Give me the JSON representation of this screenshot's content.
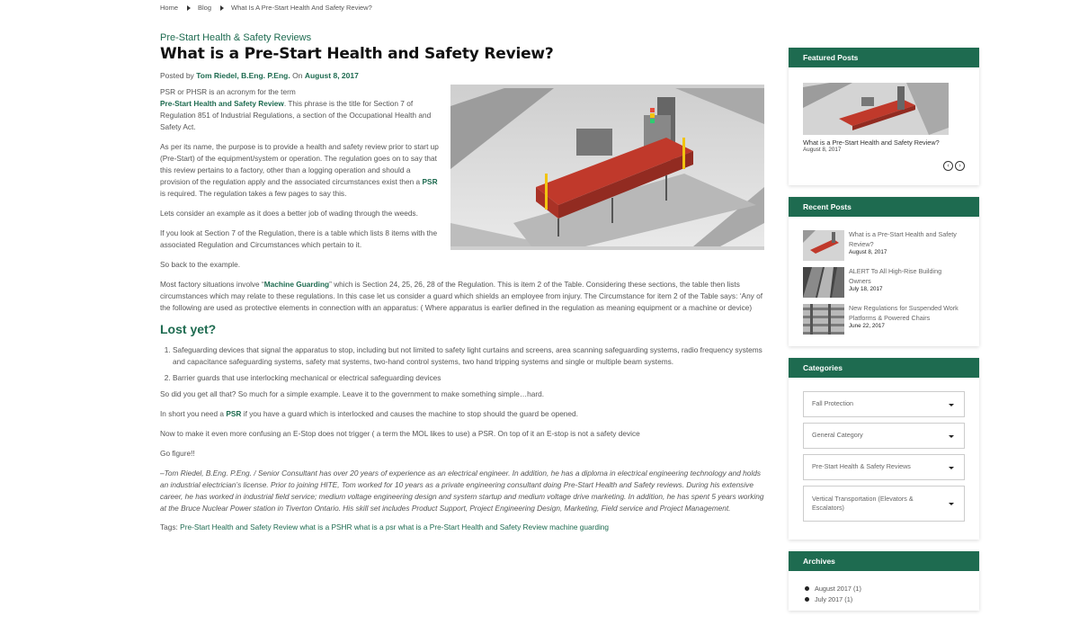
{
  "breadcrumb": {
    "home": "Home",
    "blog": "Blog",
    "current": "What Is A Pre-Start Health And Safety Review?"
  },
  "article": {
    "category": "Pre-Start Health & Safety Reviews",
    "title": "What is a Pre-Start Health and Safety Review?",
    "posted_by": "Posted by",
    "author": "Tom Riedel, B.Eng. P.Eng.",
    "on": "On",
    "date": "August 8, 2017",
    "p1_a": "PSR or PHSR is an acronym for the term",
    "p1_link": "Pre-Start Health and Safety Review",
    "p1_b": ". This phrase is the title for Section 7 of Regulation 851 of Industrial Regulations, a section of the Occupational Health and Safety Act.",
    "p2_a": "As per its name, the purpose is to provide a health and safety review prior to start up (Pre-Start) of the equipment/system or operation. The regulation goes on to say that this review pertains to a factory, other than a logging operation and should a provision of the regulation apply and the associated circumstances exist then a",
    "p2_link": "PSR",
    "p2_b": "is required. The regulation takes a few pages to say this.",
    "p3": "Lets consider an example as it does a better job of wading through the weeds.",
    "p4": "If you look at Section 7 of the Regulation, there is a table which lists 8 items with the associated Regulation and Circumstances which pertain to it.",
    "p5": "So back to the example.",
    "p6_a": "Most factory situations involve “",
    "p6_link": "Machine Guarding",
    "p6_b": "” which is Section 24, 25, 26, 28 of the Regulation. This is item 2 of the Table. Considering these sections, the table then lists circumstances which may relate to these regulations. In this case let us consider a guard which shields an employee from injury. The Circumstance for item 2 of the Table says: ‘Any of the following are used as protective elements in connection with an apparatus: ( Where apparatus is earlier defined in the regulation as meaning equipment or a machine or device)",
    "lost_heading": "Lost yet?",
    "list": [
      "Safeguarding devices that signal the apparatus to stop, including but not limited to safety light curtains and screens, area scanning safeguarding systems, radio frequency systems and capacitance safeguarding systems, safety mat systems, two-hand control systems, two hand tripping systems and single or multiple beam systems.",
      "Barrier guards that use interlocking mechanical or electrical safeguarding devices"
    ],
    "p7": "So did you get all that? So much for a simple example. Leave it to the government to make something simple…hard.",
    "p8_a": "In short you need a",
    "p8_link": "PSR",
    "p8_b": "if you have a guard which is interlocked and causes the machine to stop should the guard be opened.",
    "p9": "Now to make it even more confusing an E-Stop does not trigger ( a term the MOL likes to use) a PSR. On top of it an E-stop is not a safety device",
    "p10": "Go figure!!",
    "bio": "–Tom Riedel, B.Eng. P.Eng. / Senior Consultant has over 20 years of experience as an electrical engineer. In addition, he has a diploma in electrical engineering technology and holds an industrial electrician’s license. Prior to joining HITE, Tom worked for 10 years as a private engineering consultant doing Pre-Start Health and Safety reviews. During his extensive career, he has worked in industrial field service; medium voltage engineering design and system startup and medium voltage drive marketing. In addition, he has spent 5 years working at the Bruce Nuclear Power station in Tiverton Ontario. His skill set includes Product Support, Project Engineering Design, Marketing, Field service and Project Management.",
    "tags_label": "Tags:",
    "tags": [
      "Pre-Start Health and Safety Review",
      "what is a PSHR",
      "what is a psr",
      "what is a Pre-Start Health and Safety Review",
      "machine guarding"
    ]
  },
  "sidebar": {
    "featured": {
      "heading": "Featured Posts",
      "title": "What is a Pre-Start Health and Safety Review?",
      "date": "August 8, 2017"
    },
    "recent": {
      "heading": "Recent Posts",
      "items": [
        {
          "title": "What is a Pre-Start Health and Safety Review?",
          "date": "August 8, 2017"
        },
        {
          "title": "ALERT To All High-Rise Building Owners",
          "date": "July 18, 2017"
        },
        {
          "title": "New Regulations for Suspended Work Platforms & Powered Chairs",
          "date": "June 22, 2017"
        }
      ]
    },
    "categories": {
      "heading": "Categories",
      "items": [
        "Fall Protection",
        "General Category",
        "Pre-Start Health & Safety Reviews",
        "Vertical Transportation (Elevators & Escalators)"
      ]
    },
    "archives": {
      "heading": "Archives",
      "items": [
        "August 2017 (1)",
        "July 2017 (1)"
      ]
    }
  },
  "colors": {
    "accent": "#1e6b50",
    "text": "#555555",
    "title": "#111111"
  }
}
